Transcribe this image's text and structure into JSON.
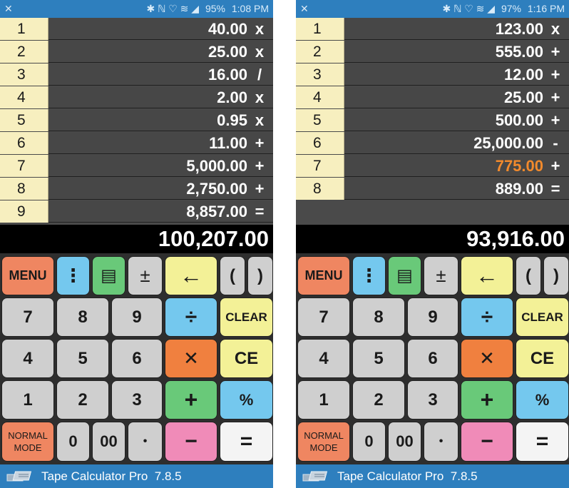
{
  "phones": [
    {
      "status": {
        "icons_right": "✱ ℕ ♡ ≋ ◢",
        "battery": "95%",
        "time": "1:08 PM"
      },
      "tape": [
        {
          "index": "1",
          "value": "40.00",
          "op": "x"
        },
        {
          "index": "2",
          "value": "25.00",
          "op": "x"
        },
        {
          "index": "3",
          "value": "16.00",
          "op": "/"
        },
        {
          "index": "4",
          "value": "2.00",
          "op": "x"
        },
        {
          "index": "5",
          "value": "0.95",
          "op": "x"
        },
        {
          "index": "6",
          "value": "11.00",
          "op": "+"
        },
        {
          "index": "7",
          "value": "5,000.00",
          "op": "+"
        },
        {
          "index": "8",
          "value": "2,750.00",
          "op": "+"
        },
        {
          "index": "9",
          "value": "8,857.00",
          "op": "="
        }
      ],
      "total": "100,207.00"
    },
    {
      "status": {
        "icons_right": "✱ ℕ ♡ ≋ ◢",
        "battery": "97%",
        "time": "1:16 PM"
      },
      "tape": [
        {
          "index": "1",
          "value": "123.00",
          "op": "x"
        },
        {
          "index": "2",
          "value": "555.00",
          "op": "+"
        },
        {
          "index": "3",
          "value": "12.00",
          "op": "+"
        },
        {
          "index": "4",
          "value": "25.00",
          "op": "+"
        },
        {
          "index": "5",
          "value": "500.00",
          "op": "+"
        },
        {
          "index": "6",
          "value": "25,000.00",
          "op": "-"
        },
        {
          "index": "7",
          "value": "775.00",
          "op": "+",
          "highlight": true
        },
        {
          "index": "8",
          "value": "889.00",
          "op": "="
        }
      ],
      "total": "93,916.00"
    }
  ],
  "keys": {
    "menu": "MENU",
    "vmore": "⋮",
    "tape_icon": "▤",
    "plusminus": "±",
    "backspace": "←",
    "paren_open": "(",
    "paren_close": ")",
    "k7": "7",
    "k8": "8",
    "k9": "9",
    "divide": "÷",
    "clear": "CLEAR",
    "k4": "4",
    "k5": "5",
    "k6": "6",
    "multiply": "✕",
    "ce": "CE",
    "k1": "1",
    "k2": "2",
    "k3": "3",
    "plus": "+",
    "percent": "%",
    "normal_mode_1": "NORMAL",
    "normal_mode_2": "MODE",
    "k0": "0",
    "k00": "00",
    "dot": "•",
    "minus": "−",
    "equals": "="
  },
  "app": {
    "title": "Tape Calculator Pro",
    "version": "7.8.5"
  },
  "colors": {
    "menu": "#ef8661",
    "blue": "#74c8ee",
    "green": "#69c979",
    "yellow": "#f3f197",
    "orange": "#f0803f",
    "pink": "#f08bb8",
    "highlight": "#f28a2c",
    "statusbar": "#2e7fbe"
  }
}
